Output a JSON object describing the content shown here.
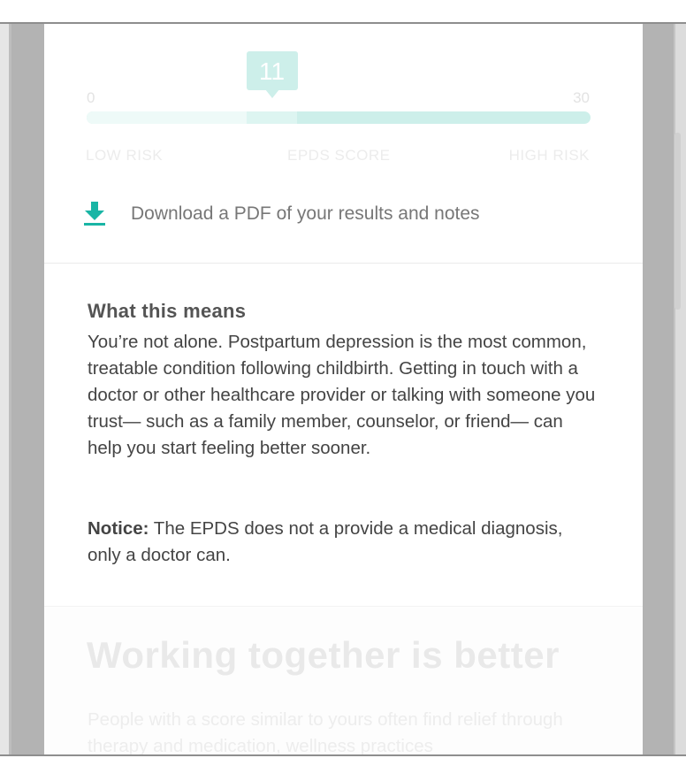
{
  "score": {
    "value": "11",
    "min_label": "0",
    "max_label": "30",
    "min": 0,
    "max": 30,
    "low_label": "LOW RISK",
    "middle_label": "EPDS SCORE",
    "high_label": "HIGH RISK"
  },
  "download": {
    "icon": "download-icon",
    "label": "Download a PDF of your results and notes"
  },
  "what_this_means": {
    "title": "What this means",
    "body": "You’re not alone. Postpartum depression is the most common, treatable condition following childbirth. Getting in touch with a doctor or other healthcare provider or talking with someone you trust— such as a family member, counselor, or friend— can help you start feeling better sooner.",
    "notice_label": "Notice:",
    "notice_text": " The EPDS does not a provide a medical diagnosis, only a doctor can."
  },
  "working_together": {
    "title": "Working together is better",
    "body": "People with a score similar to yours often find relief through therapy and medication, wellness practices"
  },
  "colors": {
    "accent": "#19b5a5",
    "bar": "#cdefea",
    "text": "#444444"
  }
}
